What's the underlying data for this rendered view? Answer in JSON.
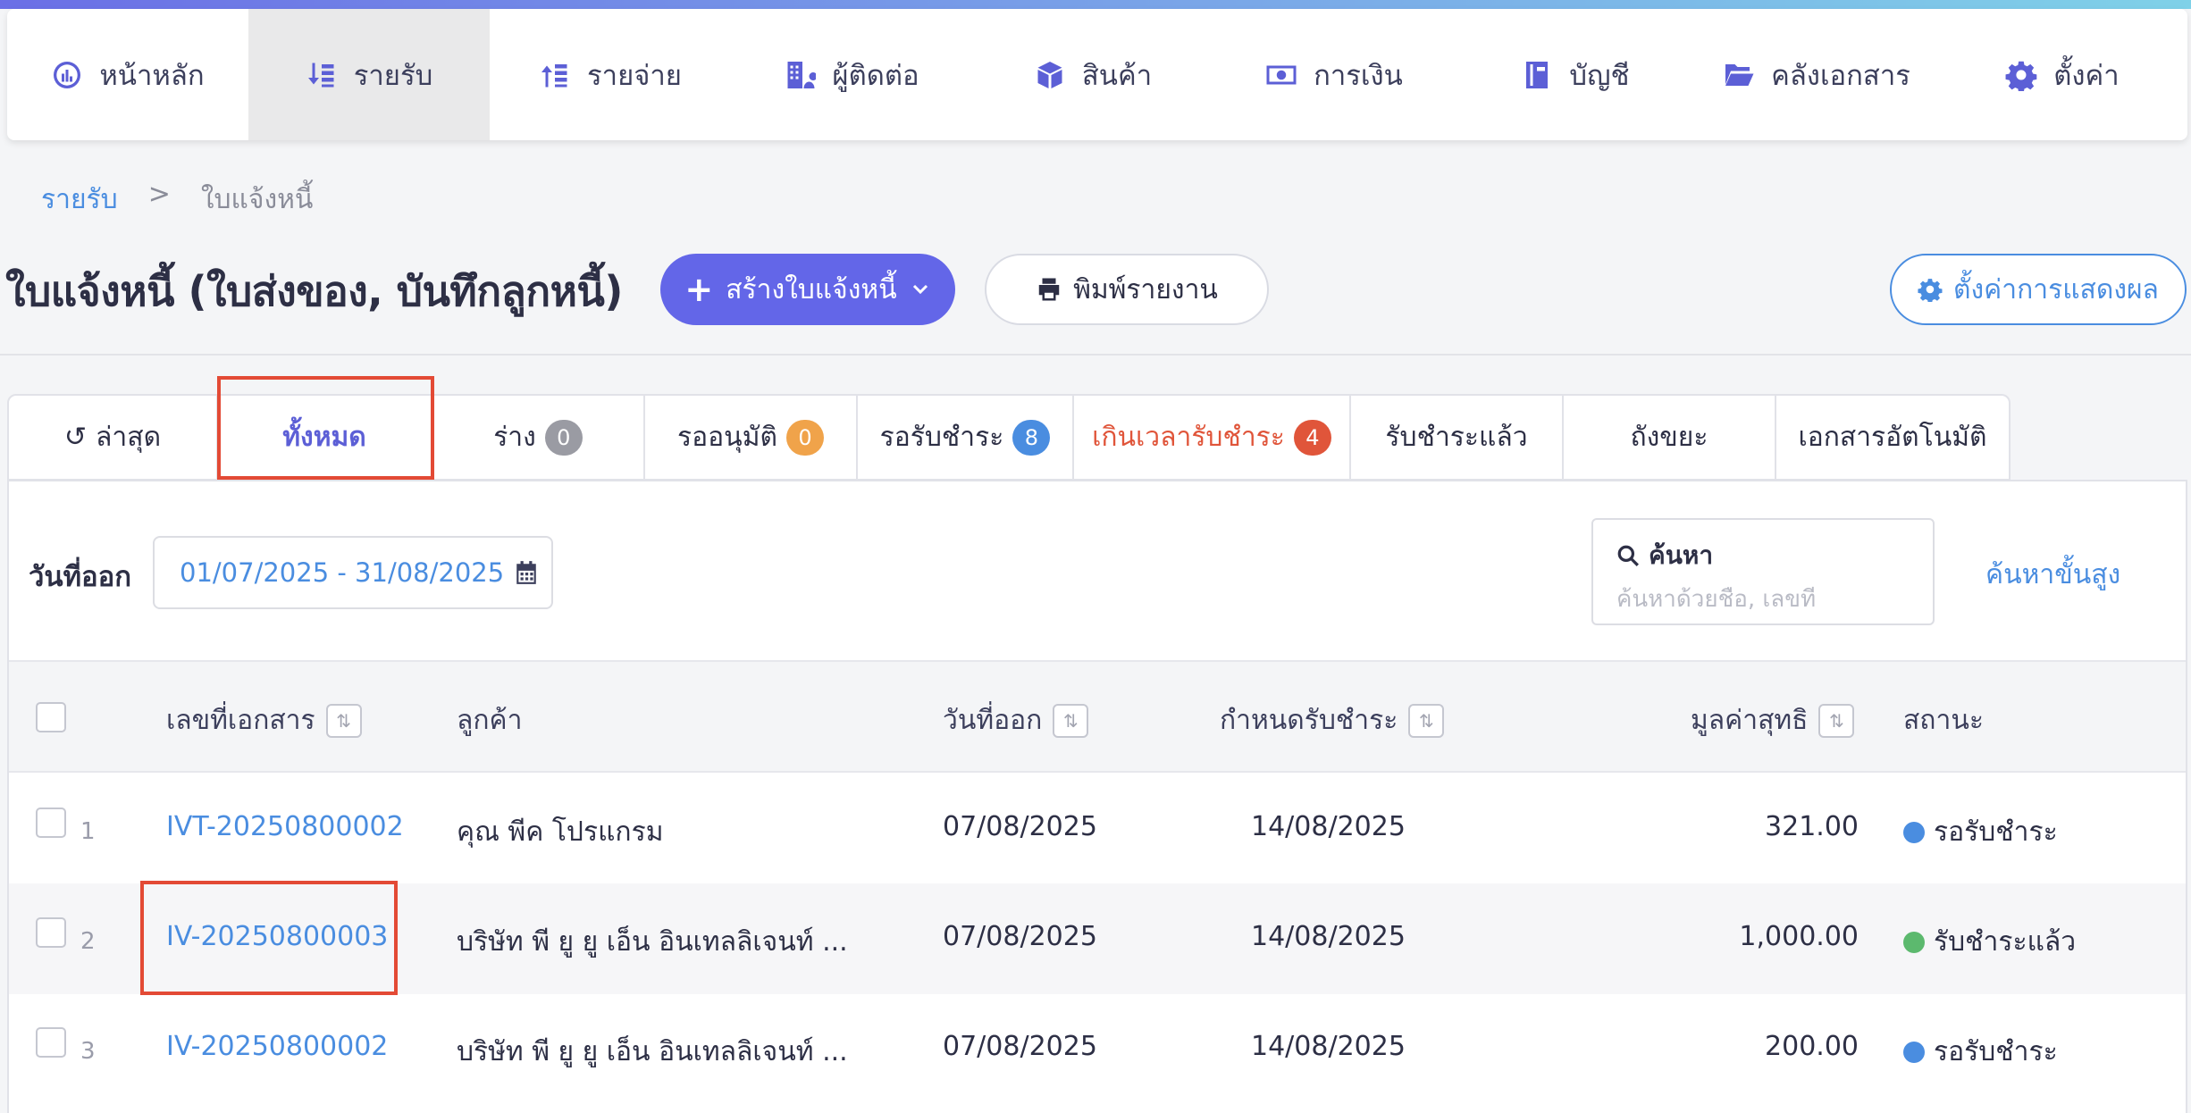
{
  "nav": {
    "items": [
      {
        "label": "หน้าหลัก",
        "icon": "dashboard-icon"
      },
      {
        "label": "รายรับ",
        "icon": "income-icon"
      },
      {
        "label": "รายจ่าย",
        "icon": "expense-icon"
      },
      {
        "label": "ผู้ติดต่อ",
        "icon": "contacts-icon"
      },
      {
        "label": "สินค้า",
        "icon": "box-icon"
      },
      {
        "label": "การเงิน",
        "icon": "money-icon"
      },
      {
        "label": "บัญชี",
        "icon": "ledger-icon"
      },
      {
        "label": "คลังเอกสาร",
        "icon": "folder-icon"
      },
      {
        "label": "ตั้งค่า",
        "icon": "gear-icon"
      }
    ],
    "active_index": 1
  },
  "breadcrumb": {
    "parent": "รายรับ",
    "separator": ">",
    "current": "ใบแจ้งหนี้"
  },
  "page": {
    "title": "ใบแจ้งหนี้ (ใบส่งของ, บันทึกลูกหนี้)",
    "create_button": "สร้างใบแจ้งหนี้",
    "print_button": "พิมพ์รายงาน",
    "settings_button": "ตั้งค่าการแสดงผล"
  },
  "tabs": [
    {
      "label": "ล่าสุด",
      "badge": null
    },
    {
      "label": "ทั้งหมด",
      "badge": null
    },
    {
      "label": "ร่าง",
      "badge": "0"
    },
    {
      "label": "รออนุมัติ",
      "badge": "0"
    },
    {
      "label": "รอรับชำระ",
      "badge": "8"
    },
    {
      "label": "เกินเวลารับชำระ",
      "badge": "4"
    },
    {
      "label": "รับชำระแล้ว",
      "badge": null
    },
    {
      "label": "ถังขยะ",
      "badge": null
    },
    {
      "label": "เอกสารอัตโนมัติ",
      "badge": null
    }
  ],
  "filter": {
    "date_label": "วันที่ออก",
    "date_range": "01/07/2025 - 31/08/2025",
    "search_title": "ค้นหา",
    "search_placeholder": "ค้นหาด้วยชื่อ, เลขที่",
    "advanced_search": "ค้นหาขั้นสูง"
  },
  "table": {
    "columns": {
      "doc_no": "เลขที่เอกสาร",
      "customer": "ลูกค้า",
      "issue_date": "วันที่ออก",
      "due_date": "กำหนดรับชำระ",
      "net_value": "มูลค่าสุทธิ",
      "status": "สถานะ"
    },
    "rows": [
      {
        "num": "1",
        "doc_no": "IVT-20250800002",
        "customer": "คุณ พีค โปรแกรม",
        "issue_date": "07/08/2025",
        "due_date": "14/08/2025",
        "net_value": "321.00",
        "status": "รอรับชำระ"
      },
      {
        "num": "2",
        "doc_no": "IV-20250800003",
        "customer": "บริษัท พี ยู ยู เอ็น อินเทลลิเจนท์ ...",
        "issue_date": "07/08/2025",
        "due_date": "14/08/2025",
        "net_value": "1,000.00",
        "status": "รับชำระแล้ว"
      },
      {
        "num": "3",
        "doc_no": "IV-20250800002",
        "customer": "บริษัท พี ยู ยู เอ็น อินเทลลิเจนท์ ...",
        "issue_date": "07/08/2025",
        "due_date": "14/08/2025",
        "net_value": "200.00",
        "status": "รอรับชำระ"
      }
    ]
  },
  "colors": {
    "accent": "#6366e8",
    "link": "#4a8de0",
    "badge_grey": "#9a9ba3",
    "badge_orange": "#f0a34a",
    "badge_blue": "#4a8de0",
    "badge_red": "#e0553a",
    "status_pending": "#4a8de0",
    "status_paid": "#5cb96e",
    "highlight": "#e34a35"
  }
}
